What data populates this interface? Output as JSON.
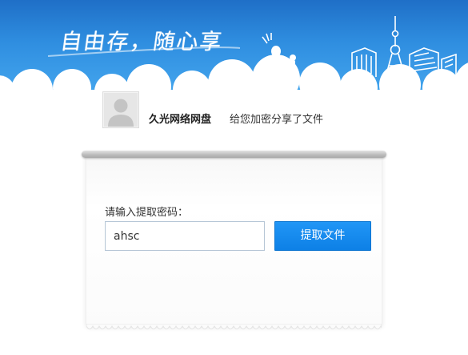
{
  "banner": {
    "slogan": "自由存，随心享"
  },
  "share": {
    "sharer_name": "久光网络网盘",
    "description": "给您加密分享了文件"
  },
  "form": {
    "label": "请输入提取密码：",
    "password_value": "ahsc",
    "submit_label": "提取文件"
  },
  "colors": {
    "banner_top": "#1f6fc7",
    "banner_bottom": "#44a6ee",
    "button": "#1a8cf0"
  }
}
